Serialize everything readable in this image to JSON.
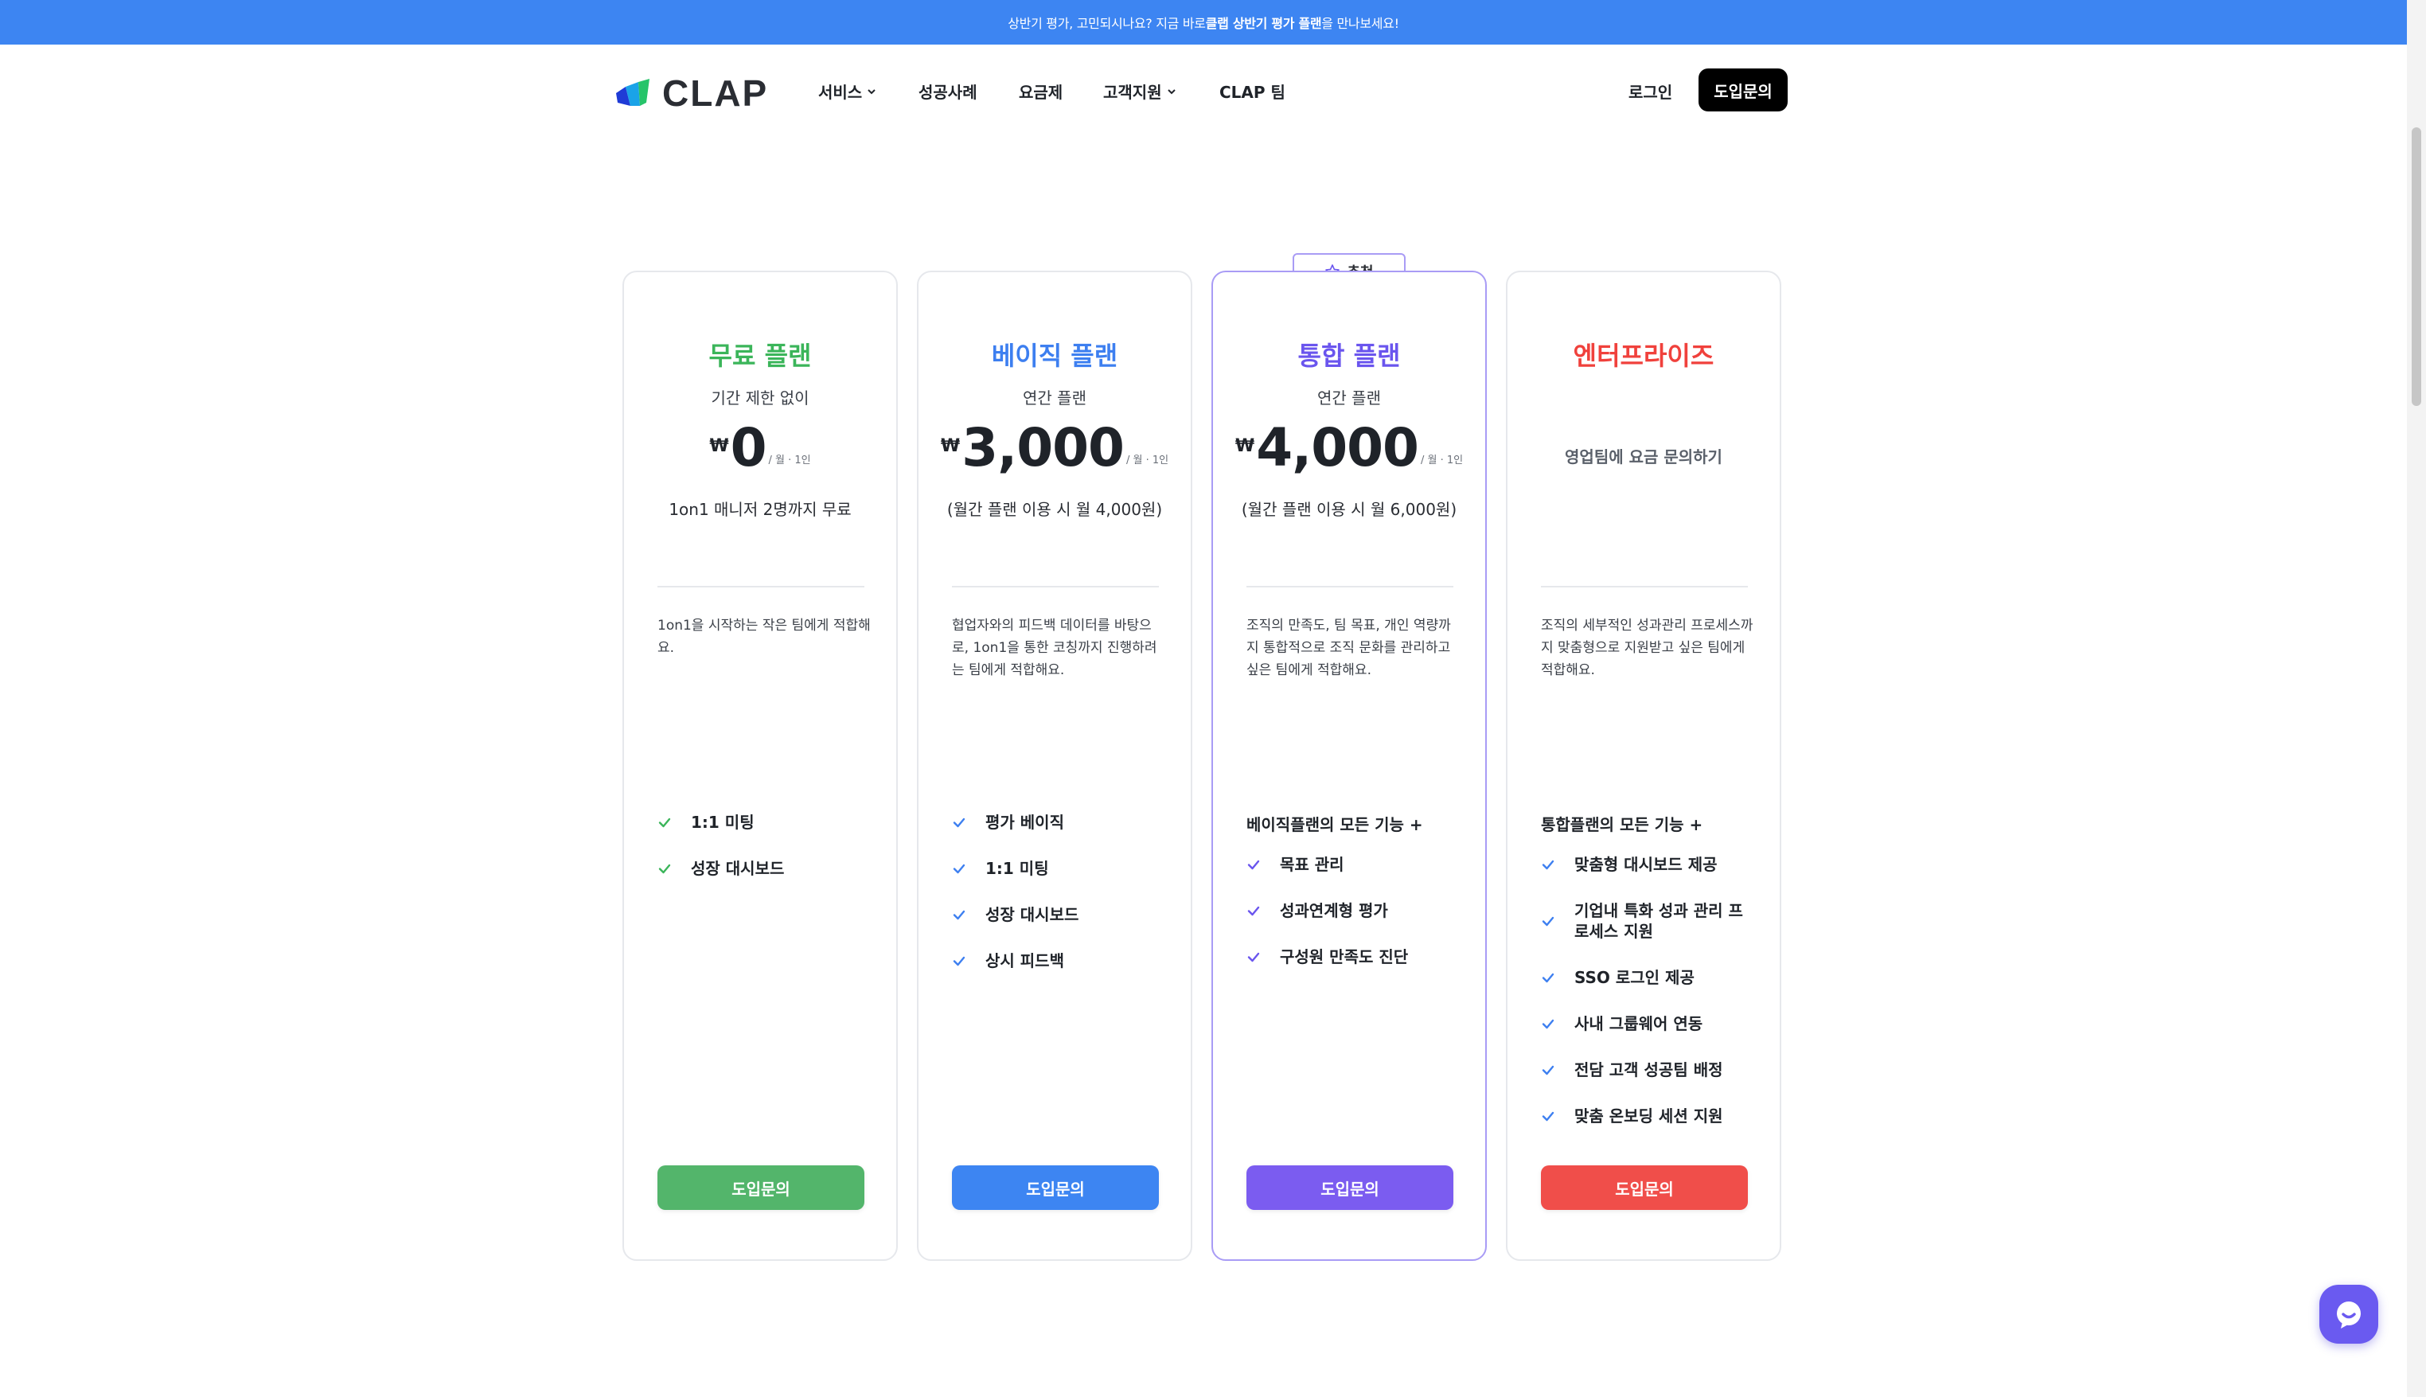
{
  "banner": {
    "prefix": "상반기 평가, 고민되시나요? 지금 바로 ",
    "highlight": "클랩 상반기 평가 플랜",
    "suffix": "을 만나보세요!"
  },
  "nav": {
    "logo_text": "CLAP",
    "items": [
      "서비스",
      "성공사례",
      "요금제",
      "고객지원",
      "CLAP 팀"
    ],
    "login": "로그인",
    "cta": "도입문의"
  },
  "recommend_badge": "추천",
  "plans": [
    {
      "name": "무료 플랜",
      "color": "#3bb55a",
      "sub": "기간 제한 없이",
      "currency": "₩",
      "price": "0",
      "unit": "/ 월 · 1인",
      "note": "1on1 매니저 2명까지 무료",
      "desc": "1on1을 시작하는 작은 팀에게 적합해요.",
      "features_head": "",
      "features": [
        "1:1 미팅",
        "성장 대시보드"
      ],
      "button": "도입문의",
      "button_color": "#53b56b",
      "check_color": "#3bb55a"
    },
    {
      "name": "베이직 플랜",
      "color": "#3d7ff0",
      "sub": "연간 플랜",
      "currency": "₩",
      "price": "3,000",
      "unit": "/ 월 · 1인",
      "note": "(월간 플랜 이용 시 월 4,000원)",
      "desc": "협업자와의 피드백 데이터를 바탕으로, 1on1을 통한 코칭까지 진행하려는 팀에게 적합해요.",
      "features_head": "",
      "features": [
        "평가 베이직",
        "1:1 미팅",
        "성장 대시보드",
        "상시 피드백"
      ],
      "button": "도입문의",
      "button_color": "#3d85f2",
      "check_color": "#3d7ff0"
    },
    {
      "name": "통합 플랜",
      "color": "#6a55ee",
      "sub": "연간 플랜",
      "currency": "₩",
      "price": "4,000",
      "unit": "/ 월 · 1인",
      "note": "(월간 플랜 이용 시 월 6,000원)",
      "desc": "조직의 만족도, 팀 목표, 개인 역량까지 통합적으로 조직 문화를 관리하고 싶은 팀에게 적합해요.",
      "features_head": "베이직플랜의 모든 기능 +",
      "features": [
        "목표 관리",
        "성과연계형 평가",
        "구성원 만족도 진단"
      ],
      "button": "도입문의",
      "button_color": "#7b5cf0",
      "check_color": "#6a55ee"
    },
    {
      "name": "엔터프라이즈",
      "color": "#f0413c",
      "inquiry": "영업팀에 요금 문의하기",
      "desc": "조직의 세부적인 성과관리 프로세스까지 맞춤형으로 지원받고 싶은 팀에게 적합해요.",
      "features_head": "통합플랜의 모든 기능 +",
      "features": [
        "맞춤형 대시보드 제공",
        "기업내 특화 성과 관리 프로세스 지원",
        "SSO 로그인 제공",
        "사내 그룹웨어 연동",
        "전담 고객 성공팀 배정",
        "맞춤 온보딩 세션 지원"
      ],
      "button": "도입문의",
      "button_color": "#f04e4a",
      "check_color": "#3d7ff0"
    }
  ]
}
